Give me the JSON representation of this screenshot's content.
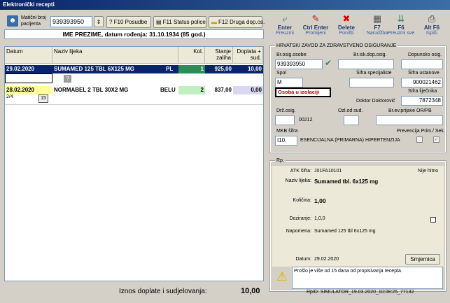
{
  "window": {
    "title": "Elektronički recepti"
  },
  "toolbar": {
    "mbo_label": "Matični broj pacijenta",
    "mbo_value": "939393950",
    "posudbe": "? F10 Posudbe",
    "status_police": "F11 Status police",
    "druga_dop": "F12 Druga dop.os."
  },
  "patient_line": "IME PREZIME, datum rođenja: 31.10.1934 (85 god.)",
  "grid": {
    "headers": {
      "datum": "Datum",
      "naziv": "Naziv lijeka",
      "kol": "Kol.",
      "stanje": "Stanje zaliha",
      "doplata": "Doplata + sud."
    },
    "rows": [
      {
        "datum": "29.02.2020",
        "naziv": "SUMAMED 125 TBL 6X125 MG",
        "oznaka": "PL",
        "kol": "1",
        "stanje": "925,00",
        "doplata": "10,00"
      },
      {
        "datum": "28.02.2020",
        "naziv": "NORMABEL 2 TBL 30X2 MG",
        "oznaka": "BELU",
        "kol": "2",
        "stanje": "837,00",
        "doplata": "0,00"
      }
    ],
    "extra_num": "15",
    "fraction": "2/4"
  },
  "right_toolbar": [
    {
      "key": "Enter",
      "label": "Preuzmi",
      "icon": "enter-icon"
    },
    {
      "key": "Ctrl Enter",
      "label": "Promijeni",
      "icon": "edit-icon"
    },
    {
      "key": "Delete",
      "label": "Poništi",
      "icon": "delete-icon"
    },
    {
      "key": "F7",
      "label": "Narudžba",
      "icon": "order-icon"
    },
    {
      "key": "F6",
      "label": "Preuzmi sve",
      "icon": "download-all-icon"
    },
    {
      "key": "Alt F6",
      "label": "Ispiši",
      "icon": "printer-icon"
    }
  ],
  "hzzo": {
    "title": "HRVATSKI ZAVOD ZA ZDRAVSTVENO OSIGURANJE",
    "br_osig_label": "Br.osig.osobe:",
    "br_osig_value": "939393950",
    "br_isk_label": "Br.isk.dop.osig.",
    "dopunsko_label": "Dopunsko osig.",
    "spol_label": "Spol",
    "spol_value": "M",
    "sifra_spec_label": "Šifra specijaliste",
    "sifra_ust_label": "Šifra ustanove",
    "sifra_ust_value": "900021462",
    "osoba_izolacija": "Osoba u izolaciji",
    "sifra_lij_label": "Šifra liječnika",
    "doktor_label": "Doktor Doktorović",
    "doktor_value": "7872348",
    "drz_osig_label": "Drž.osig.",
    "drz_osig_value": "00212",
    "ozl_label": "Ozl.od sud.",
    "br_ev_label": "Br.ev.prijave OR/PB",
    "mkb_label": "MKB šifra",
    "mkb_value": "I10.",
    "mkb_desc": "ESENCIJALNA (PRIMARNA) HIPERTENZIJA",
    "prevencija_label": "Prevencija Prim./ Sek."
  },
  "rp": {
    "title": "Rp.",
    "atk_label": "ATK šifra:",
    "atk_value": "J01FA10101",
    "nije_hitno": "Nije hitno",
    "naziv_label": "Naziv lijeka:",
    "naziv_value": "Sumamed tbl. 6x125 mg",
    "kolicina_label": "Količina:",
    "kolicina_value": "1,00",
    "doziranje_label": "Doziranje:",
    "doziranje_value": "1,0,0",
    "napomena_label": "Napomena:",
    "napomena_value": "Sumamed 125 tbl 6x125 mg",
    "datum_label": "Datum:",
    "datum_value": "29.02.2020",
    "smjernica": "Smjernica",
    "warning": "Prošlo je više od 15 dana od propisivanja recepta."
  },
  "footer": {
    "iznos_label": "Iznos doplate i sudjelovanja:",
    "iznos_value": "10,00",
    "rpid": "RpID: SIMULATOR_19.03.2020_10:08:25_77132"
  }
}
